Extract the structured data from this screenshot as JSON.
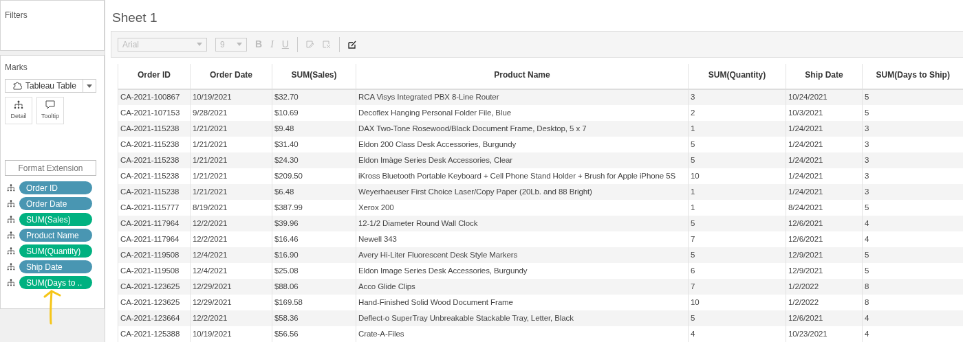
{
  "filters": {
    "title": "Filters"
  },
  "marks": {
    "title": "Marks",
    "mark_type": "Tableau Table",
    "cards": [
      {
        "label": "Detail",
        "kind": "detail"
      },
      {
        "label": "Tooltip",
        "kind": "tooltip"
      }
    ],
    "extension_button": "Format Extension",
    "pills": [
      {
        "label": "Order ID",
        "color": "#4996b2"
      },
      {
        "label": "Order Date",
        "color": "#4996b2"
      },
      {
        "label": "SUM(Sales)",
        "color": "#00b180"
      },
      {
        "label": "Product Name",
        "color": "#4996b2"
      },
      {
        "label": "SUM(Quantity)",
        "color": "#00b180"
      },
      {
        "label": "Ship Date",
        "color": "#4996b2"
      },
      {
        "label": "SUM(Days to ..",
        "color": "#00b180"
      }
    ]
  },
  "sheet": {
    "title": "Sheet 1"
  },
  "toolbar": {
    "font": "Arial",
    "size": "9",
    "disabled": true,
    "buttons": [
      {
        "label": "B",
        "kind": "bold"
      },
      {
        "label": "I",
        "kind": "italic"
      },
      {
        "label": "U",
        "kind": "underline"
      }
    ]
  },
  "table": {
    "columns": [
      "Order ID",
      "Order Date",
      "SUM(Sales)",
      "Product Name",
      "SUM(Quantity)",
      "Ship Date",
      "SUM(Days to Ship)"
    ],
    "rows": [
      [
        "CA-2021-100867",
        "10/19/2021",
        "$32.70",
        "RCA Visys Integrated PBX 8-Line Router",
        "3",
        "10/24/2021",
        "5"
      ],
      [
        "CA-2021-107153",
        "9/28/2021",
        "$10.69",
        "Decoflex Hanging Personal Folder File, Blue",
        "2",
        "10/3/2021",
        "5"
      ],
      [
        "CA-2021-115238",
        "1/21/2021",
        "$9.48",
        "DAX Two-Tone Rosewood/Black Document Frame, Desktop, 5 x 7",
        "1",
        "1/24/2021",
        "3"
      ],
      [
        "CA-2021-115238",
        "1/21/2021",
        "$31.40",
        "Eldon 200 Class Desk Accessories, Burgundy",
        "5",
        "1/24/2021",
        "3"
      ],
      [
        "CA-2021-115238",
        "1/21/2021",
        "$24.30",
        "Eldon Imàge Series Desk Accessories, Clear",
        "5",
        "1/24/2021",
        "3"
      ],
      [
        "CA-2021-115238",
        "1/21/2021",
        "$209.50",
        "iKross Bluetooth Portable Keyboard + Cell Phone Stand Holder + Brush for Apple iPhone 5S",
        "10",
        "1/24/2021",
        "3"
      ],
      [
        "CA-2021-115238",
        "1/21/2021",
        "$6.48",
        "Weyerhaeuser First Choice Laser/Copy Paper (20Lb. and 88 Bright)",
        "1",
        "1/24/2021",
        "3"
      ],
      [
        "CA-2021-115777",
        "8/19/2021",
        "$387.99",
        "Xerox 200",
        "1",
        "8/24/2021",
        "5"
      ],
      [
        "CA-2021-117964",
        "12/2/2021",
        "$39.96",
        "12-1/2 Diameter Round Wall Clock",
        "5",
        "12/6/2021",
        "4"
      ],
      [
        "CA-2021-117964",
        "12/2/2021",
        "$16.46",
        "Newell 343",
        "7",
        "12/6/2021",
        "4"
      ],
      [
        "CA-2021-119508",
        "12/4/2021",
        "$16.90",
        "Avery Hi-Liter Fluorescent Desk Style Markers",
        "5",
        "12/9/2021",
        "5"
      ],
      [
        "CA-2021-119508",
        "12/4/2021",
        "$25.08",
        "Eldon Image Series Desk Accessories, Burgundy",
        "6",
        "12/9/2021",
        "5"
      ],
      [
        "CA-2021-123625",
        "12/29/2021",
        "$88.06",
        "Acco Glide Clips",
        "7",
        "1/2/2022",
        "8"
      ],
      [
        "CA-2021-123625",
        "12/29/2021",
        "$169.58",
        "Hand-Finished Solid Wood Document Frame",
        "10",
        "1/2/2022",
        "8"
      ],
      [
        "CA-2021-123664",
        "12/2/2021",
        "$58.36",
        "Deflect-o SuperTray Unbreakable Stackable Tray, Letter, Black",
        "5",
        "12/6/2021",
        "4"
      ],
      [
        "CA-2021-125388",
        "10/19/2021",
        "$56.56",
        "Crate-A-Files",
        "4",
        "10/23/2021",
        "4"
      ]
    ]
  }
}
